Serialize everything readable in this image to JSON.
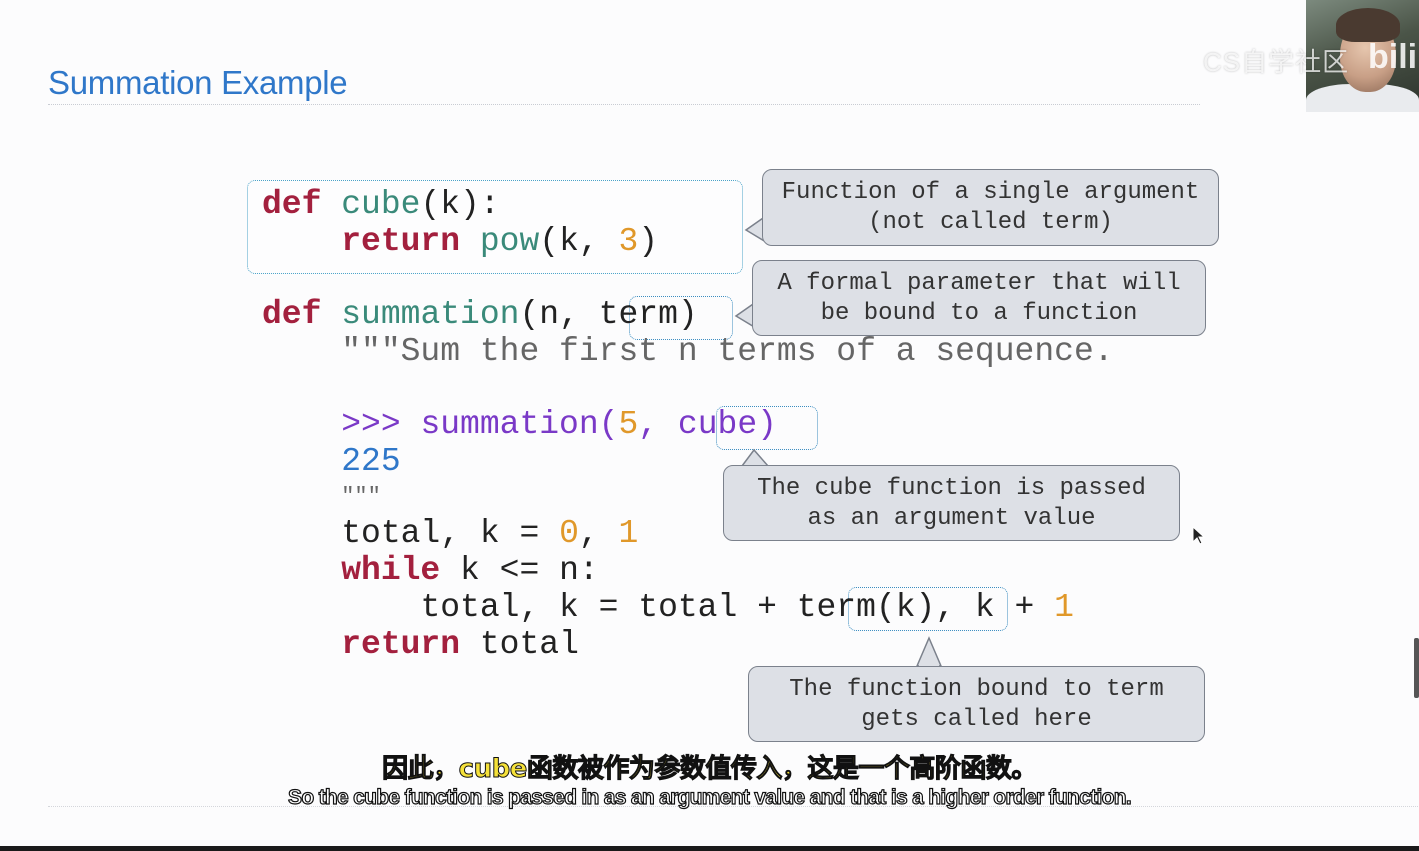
{
  "slide": {
    "title": "Summation Example"
  },
  "code": {
    "cube_def": [
      "def",
      " cube",
      "(k):"
    ],
    "cube_return": [
      "return",
      " pow",
      "(k, ",
      "3",
      ")"
    ],
    "sum_def": [
      "def",
      " summation",
      "(n, ",
      "term",
      ")"
    ],
    "docstring": "\"\"\"Sum the first n terms of a sequence.",
    "doctest_prompt": ">>> ",
    "doctest_call": "summation(",
    "doctest_num": "5",
    "doctest_sep": ", ",
    "doctest_arg": "cube",
    "doctest_close": ")",
    "doctest_output": "225",
    "docstring_end": "\"\"\"",
    "init_line": [
      "total, k = ",
      "0",
      ", ",
      "1"
    ],
    "while_line": [
      "while",
      " k <= n:"
    ],
    "update_line": [
      "total, k = total + ",
      "term(k)",
      ", k + ",
      "1"
    ],
    "return_line": [
      "return",
      " total"
    ]
  },
  "callouts": {
    "single_argument": "Function of a single argument\n(not called term)",
    "formal_parameter": "A formal parameter that will\nbe bound to a function",
    "passed_as_argument": "The cube function is passed\nas an argument value",
    "called_here": "The function bound to term\ngets called here"
  },
  "overlay": {
    "watermark": "CS自学社区",
    "logo": "bili"
  },
  "subtitles": {
    "zh": "因此，cube函数被作为参数值传入，这是一个高阶函数。",
    "en": "So the cube function is passed in as an argument value and that is a higher order function."
  },
  "colors": {
    "title": "#2f77c9",
    "keyword": "#a3203e",
    "function": "#3a8a7a",
    "number": "#e0982a",
    "prompt": "#7a39c7",
    "output": "#2f77c9",
    "subtitle_zh": "#f5e13a"
  }
}
